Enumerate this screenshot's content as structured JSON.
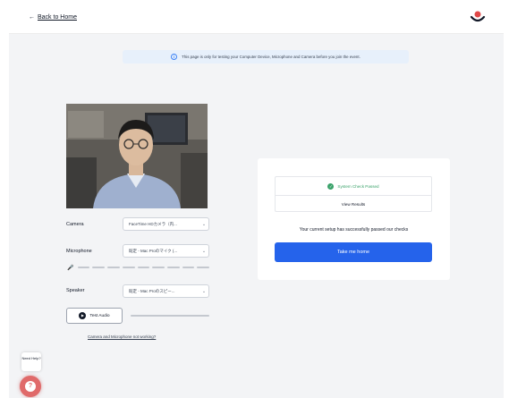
{
  "header": {
    "back_label": "Back to Home",
    "logo_icon": "brand-logo-icon"
  },
  "banner": {
    "text": "This page is only for testing your Computer Device, Microphone and Camera before you join the event.",
    "icon": "info-icon"
  },
  "devices": {
    "camera": {
      "label": "Camera",
      "value": "FaceTime HDカメラ（内..."
    },
    "microphone": {
      "label": "Microphone",
      "value": "既定 - Mac Proのマイク (..."
    },
    "speaker": {
      "label": "Speaker",
      "value": "既定 - Mac Proのスピー..."
    },
    "test_audio_label": "Test Audio",
    "help_link": "Camera and Microphone not working?"
  },
  "status": {
    "passed_label": "System Check Passed",
    "view_results_label": "View Results",
    "message": "Your current setup has successfully passed our checks",
    "take_home_label": "Take me home"
  },
  "support": {
    "need_help": "Need Help?"
  },
  "colors": {
    "primary": "#2563eb",
    "success": "#3aa26a",
    "brand": "#e04848",
    "background": "#f3f4f6"
  }
}
